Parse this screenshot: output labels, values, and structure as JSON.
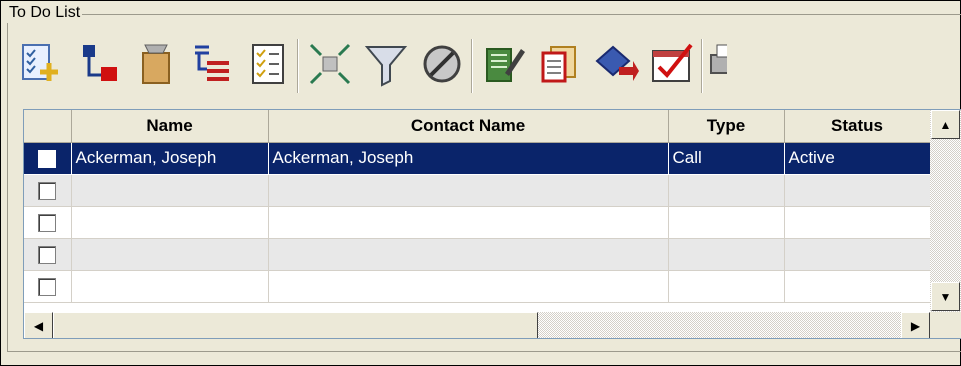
{
  "group_title": "To Do List",
  "toolbar": {
    "buttons": [
      {
        "icon": "new-todo-icon"
      },
      {
        "icon": "assign-icon"
      },
      {
        "icon": "archive-icon"
      },
      {
        "icon": "outline-list-icon"
      },
      {
        "icon": "checklist-icon"
      },
      {
        "icon": "collapse-icon"
      },
      {
        "icon": "filter-icon"
      },
      {
        "icon": "clear-filter-icon"
      },
      {
        "icon": "edit-notes-icon"
      },
      {
        "icon": "copy-document-icon"
      },
      {
        "icon": "transfer-icon"
      },
      {
        "icon": "complete-calendar-icon"
      },
      {
        "icon": "print-icon"
      }
    ]
  },
  "table": {
    "columns": [
      "",
      "Name",
      "Contact Name",
      "Type",
      "Status"
    ],
    "rows": [
      {
        "checked": false,
        "selected": true,
        "name": "Ackerman, Joseph",
        "contact": "Ackerman, Joseph",
        "type": "Call",
        "status": "Active"
      },
      {
        "checked": false,
        "selected": false,
        "name": "",
        "contact": "",
        "type": "",
        "status": ""
      },
      {
        "checked": false,
        "selected": false,
        "name": "",
        "contact": "",
        "type": "",
        "status": ""
      },
      {
        "checked": false,
        "selected": false,
        "name": "",
        "contact": "",
        "type": "",
        "status": ""
      },
      {
        "checked": false,
        "selected": false,
        "name": "",
        "contact": "",
        "type": "",
        "status": ""
      }
    ]
  },
  "colors": {
    "selection": "#0a246a",
    "panel": "#ece9d8",
    "alt_row": "#e8e8e8"
  }
}
